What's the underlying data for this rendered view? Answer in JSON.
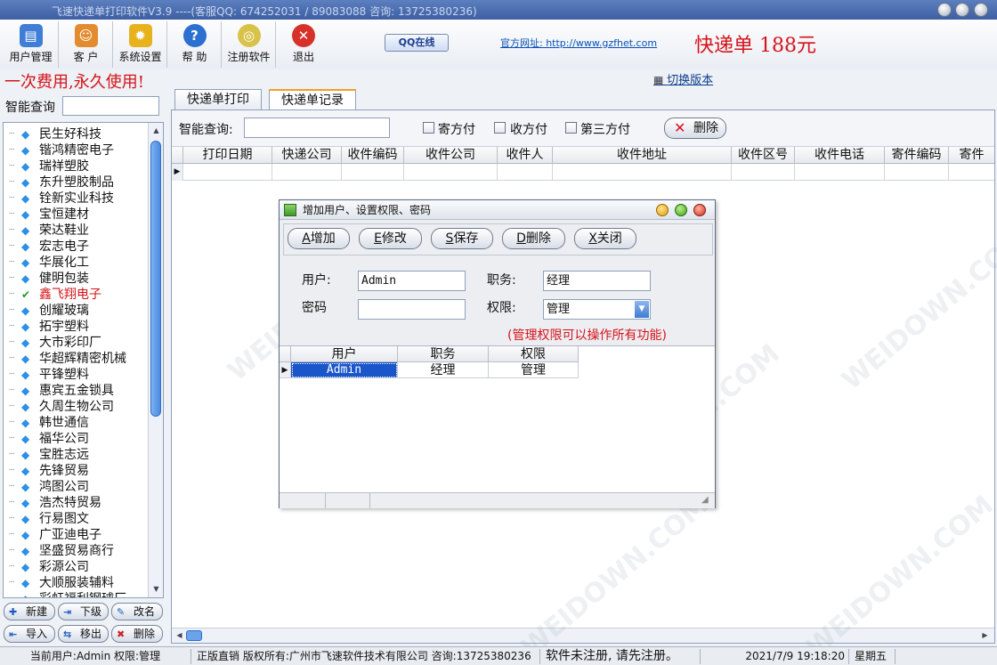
{
  "window": {
    "title": "飞速快递单打印软件V3.9  ----(客服QQ: 674252031 / 89083088 咨询: 13725380236)"
  },
  "toolbar": {
    "items": [
      {
        "label": "用户管理",
        "icon": "user-card-icon",
        "glyph": "▤"
      },
      {
        "label": "客 户",
        "icon": "customers-icon",
        "glyph": "☺"
      },
      {
        "label": "系统设置",
        "icon": "gear-icon",
        "glyph": "✹"
      },
      {
        "label": "帮 助",
        "icon": "help-icon",
        "glyph": "?"
      },
      {
        "label": "注册软件",
        "icon": "disc-icon",
        "glyph": "◎"
      },
      {
        "label": "退出",
        "icon": "exit-icon",
        "glyph": "✕"
      }
    ],
    "qq": "QQ在线",
    "site": "官方网址: http://www.gzfhet.com",
    "price": "快递单 188元",
    "slogan": "一次费用,永久使用!",
    "switch": "切换版本"
  },
  "sidebar": {
    "search_label": "智能查询",
    "search_value": "",
    "customers": [
      "民生好科技",
      "锴鸿精密电子",
      "瑞祥塑胶",
      "东升塑胶制品",
      "铨新实业科技",
      "宝恒建材",
      "荣达鞋业",
      "宏志电子",
      "华展化工",
      "健明包装",
      "鑫飞翔电子",
      "创耀玻璃",
      "拓宇塑料",
      "大市彩印厂",
      "华超辉精密机械",
      "平锋塑料",
      "惠宾五金锁具",
      "久周生物公司",
      "韩世通信",
      "福华公司",
      "宝胜志远",
      "先锋贸易",
      "鸿图公司",
      "浩杰特贸易",
      "行易图文",
      "广亚迪电子",
      "坚盛贸易商行",
      "彩源公司",
      "大顺服装辅料",
      "彩虹福利钢球厂"
    ],
    "selected_index": 10,
    "buttons": {
      "new": "新建",
      "sub": "下级",
      "rename": "改名",
      "import": "导入",
      "move": "移出",
      "delete": "删除"
    }
  },
  "tabs": [
    {
      "label": "快递单打印"
    },
    {
      "label": "快递单记录"
    }
  ],
  "active_tab": 1,
  "records": {
    "search_label": "智能查询:",
    "search_value": "",
    "filters": [
      {
        "label": "寄方付",
        "checked": false
      },
      {
        "label": "收方付",
        "checked": false
      },
      {
        "label": "第三方付",
        "checked": false
      }
    ],
    "delete_label": "删除",
    "columns": [
      "打印日期",
      "快递公司",
      "收件编码",
      "收件公司",
      "收件人",
      "收件地址",
      "收件区号",
      "收件电话",
      "寄件编码",
      "寄件"
    ]
  },
  "dialog": {
    "title": "增加用户、设置权限、密码",
    "buttons": {
      "add": "增加",
      "edit": "修改",
      "save": "保存",
      "delete": "删除",
      "close": "关闭"
    },
    "user_label": "用户:",
    "user_value": "Admin",
    "role_label": "职务:",
    "role_value": "经理",
    "password_label": "密码",
    "password_value": "",
    "perm_label": "权限:",
    "perm_value": "管理",
    "hint": "(管理权限可以操作所有功能)",
    "grid": {
      "columns": [
        "用户",
        "职务",
        "权限"
      ],
      "rows": [
        [
          "Admin",
          "经理",
          "管理"
        ]
      ]
    }
  },
  "status": {
    "current_user": "当前用户:Admin   权限:管理",
    "copyright": "正版直销 版权所有:广州市飞速软件技术有限公司 咨询:13725380236",
    "reg": "软件未注册, 请先注册。",
    "datetime": "2021/7/9  19:18:20",
    "weekday": "星期五"
  },
  "colors": {
    "accent": "#d5131a",
    "title_blue": "#3d5fa3",
    "selection": "#1a56c9"
  }
}
